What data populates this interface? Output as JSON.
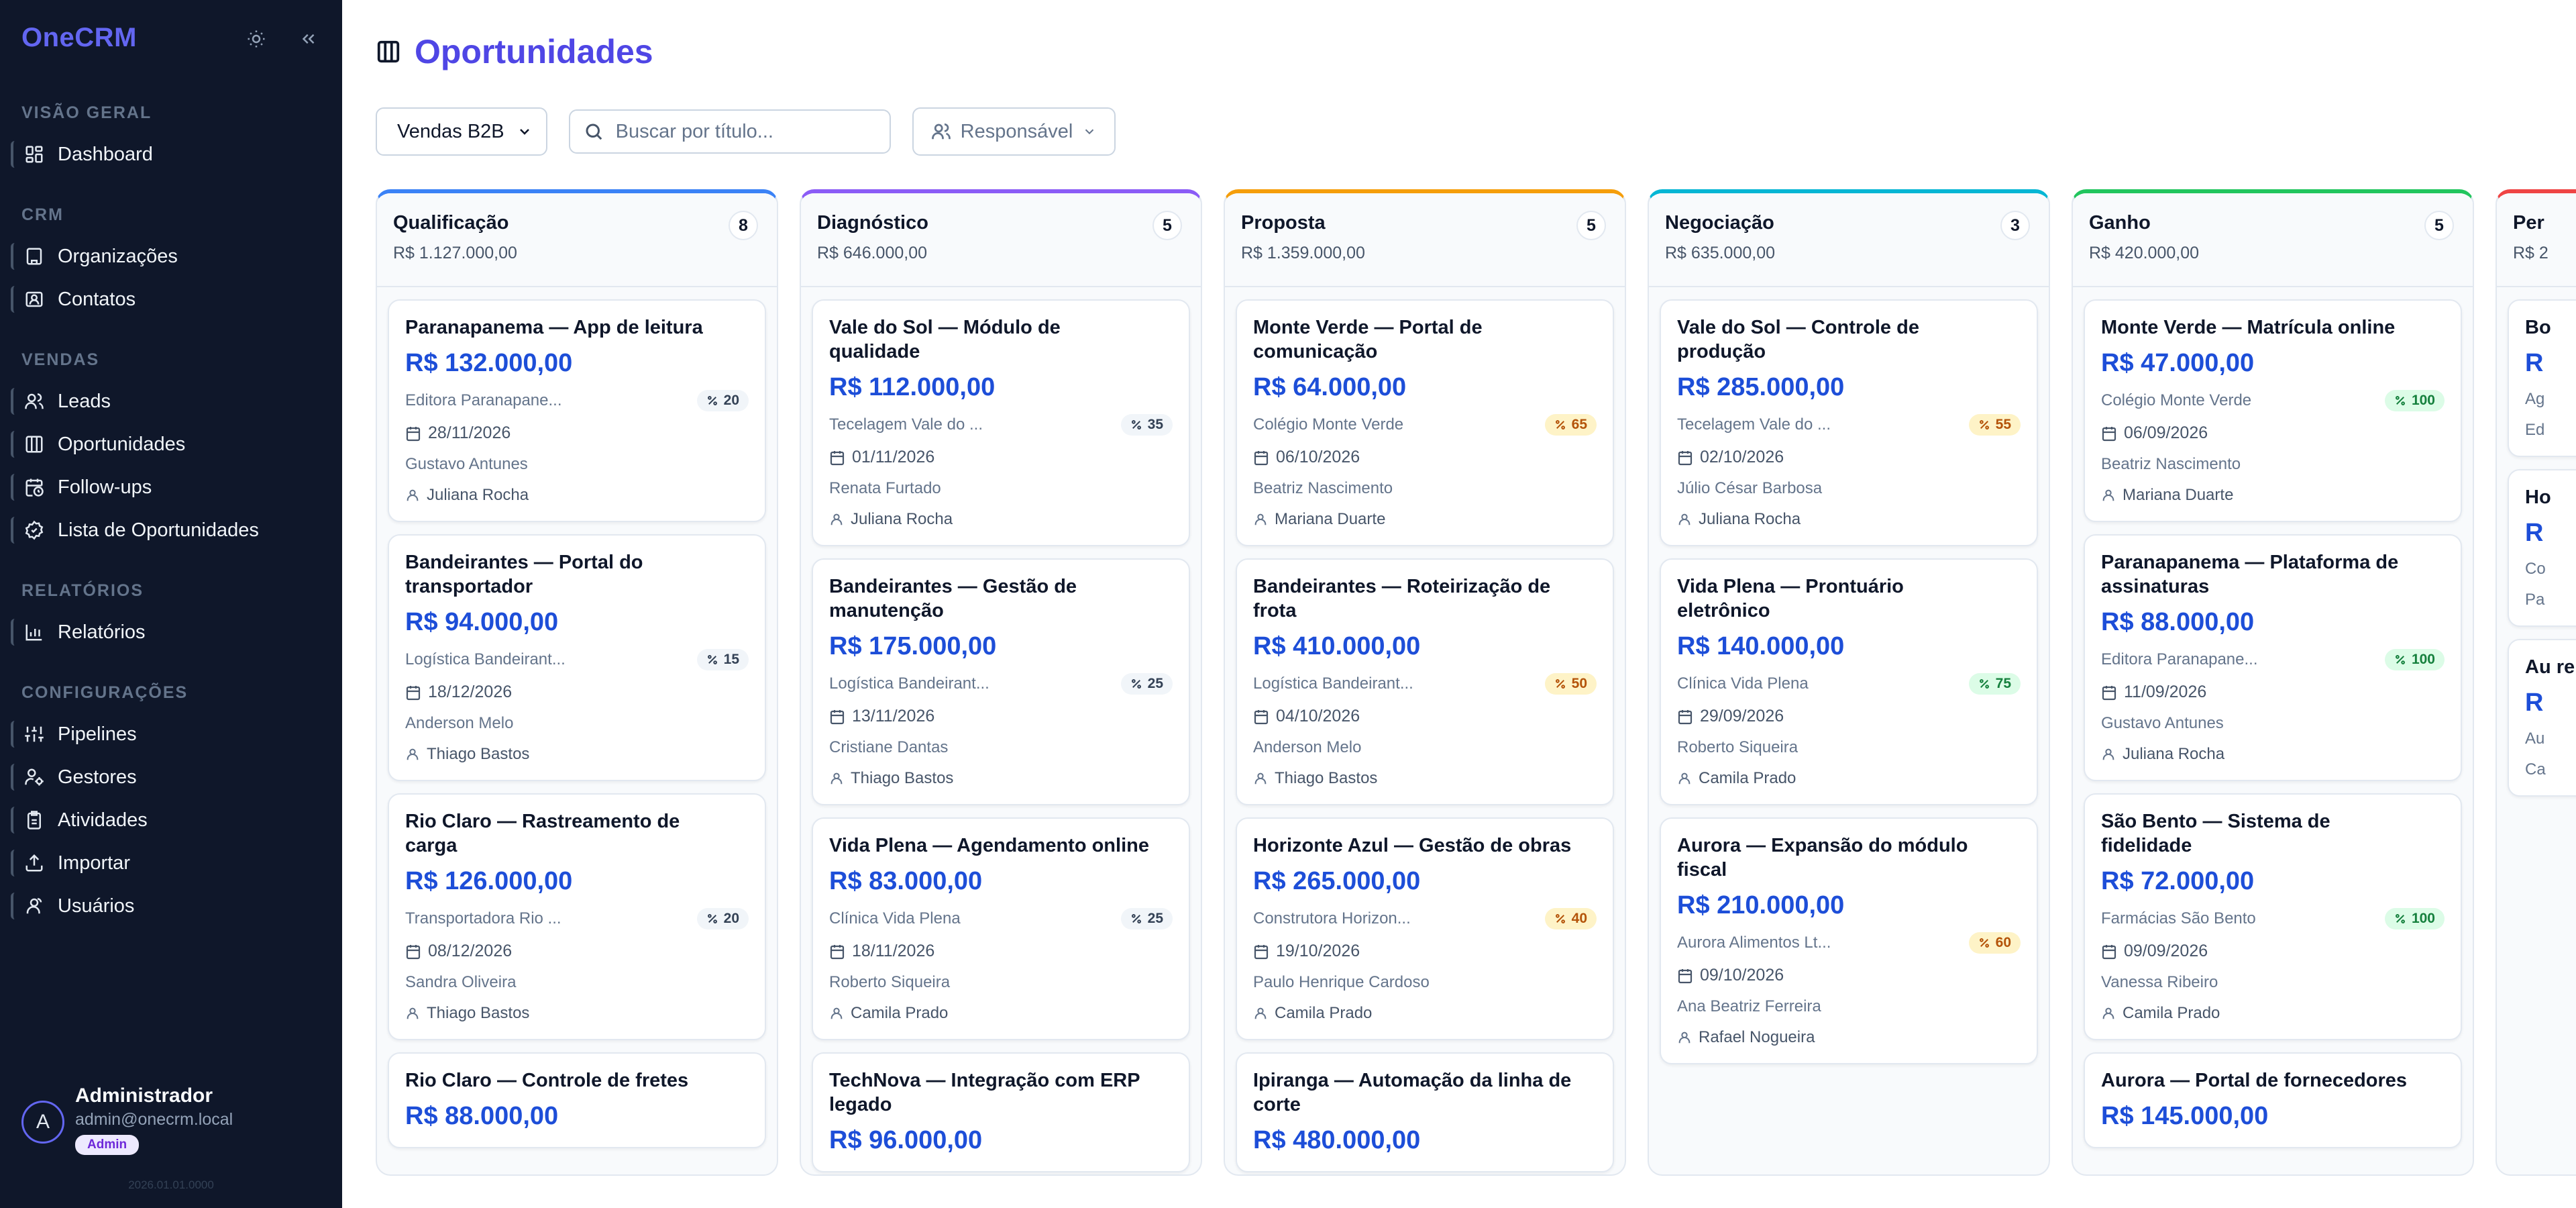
{
  "app": {
    "brand": "OneCRM"
  },
  "sidebar": {
    "groups": [
      {
        "title": "Visão geral",
        "items": [
          {
            "label": "Dashboard",
            "icon": "dashboard-icon"
          }
        ]
      },
      {
        "title": "CRM",
        "items": [
          {
            "label": "Organizações",
            "icon": "building-icon"
          },
          {
            "label": "Contatos",
            "icon": "contact-card-icon"
          }
        ]
      },
      {
        "title": "Vendas",
        "items": [
          {
            "label": "Leads",
            "icon": "users-icon"
          },
          {
            "label": "Oportunidades",
            "icon": "columns-icon"
          },
          {
            "label": "Follow-ups",
            "icon": "calendar-clock-icon"
          },
          {
            "label": "Lista de Oportunidades",
            "icon": "badge-check-icon"
          }
        ]
      },
      {
        "title": "Relatórios",
        "items": [
          {
            "label": "Relatórios",
            "icon": "bar-chart-icon"
          }
        ]
      },
      {
        "title": "Configurações",
        "items": [
          {
            "label": "Pipelines",
            "icon": "sliders-icon"
          },
          {
            "label": "Gestores",
            "icon": "user-cog-icon"
          },
          {
            "label": "Atividades",
            "icon": "clipboard-icon"
          },
          {
            "label": "Importar",
            "icon": "upload-icon"
          },
          {
            "label": "Usuários",
            "icon": "user-icon"
          }
        ]
      }
    ],
    "user": {
      "initial": "A",
      "name": "Administrador",
      "email": "admin@onecrm.local",
      "role": "Admin"
    },
    "version": "2026.01.01.0000"
  },
  "page": {
    "title": "Oportunidades"
  },
  "toolbar": {
    "pipeline_select": "Vendas B2B",
    "search_placeholder": "Buscar por título...",
    "owner_filter": "Responsável"
  },
  "colors": {
    "accent": "#4f46e5",
    "value": "#1d4ed8",
    "sidebar_bg": "#0f172a"
  },
  "columns": [
    {
      "title": "Qualificação",
      "count": "8",
      "total": "R$ 1.127.000,00",
      "color": "#3b82f6",
      "cards": [
        {
          "title": "Paranapanema — App de leitura",
          "value": "R$ 132.000,00",
          "org": "Editora Paranapane...",
          "prob": "20",
          "level": "low",
          "date": "28/11/2026",
          "contact": "Gustavo Antunes",
          "owner": "Juliana Rocha"
        },
        {
          "title": "Bandeirantes — Portal do transportador",
          "value": "R$ 94.000,00",
          "org": "Logística Bandeirant...",
          "prob": "15",
          "level": "low",
          "date": "18/12/2026",
          "contact": "Anderson Melo",
          "owner": "Thiago Bastos"
        },
        {
          "title": "Rio Claro — Rastreamento de carga",
          "value": "R$ 126.000,00",
          "org": "Transportadora Rio ...",
          "prob": "20",
          "level": "low",
          "date": "08/12/2026",
          "contact": "Sandra Oliveira",
          "owner": "Thiago Bastos"
        },
        {
          "title": "Rio Claro — Controle de fretes",
          "value": "R$ 88.000,00",
          "org": "",
          "prob": "",
          "level": "low",
          "date": "",
          "contact": "",
          "owner": ""
        }
      ]
    },
    {
      "title": "Diagnóstico",
      "count": "5",
      "total": "R$ 646.000,00",
      "color": "#8b5cf6",
      "cards": [
        {
          "title": "Vale do Sol — Módulo de qualidade",
          "value": "R$ 112.000,00",
          "org": "Tecelagem Vale do ...",
          "prob": "35",
          "level": "low",
          "date": "01/11/2026",
          "contact": "Renata Furtado",
          "owner": "Juliana Rocha"
        },
        {
          "title": "Bandeirantes — Gestão de manutenção",
          "value": "R$ 175.000,00",
          "org": "Logística Bandeirant...",
          "prob": "25",
          "level": "low",
          "date": "13/11/2026",
          "contact": "Cristiane Dantas",
          "owner": "Thiago Bastos"
        },
        {
          "title": "Vida Plena — Agendamento online",
          "value": "R$ 83.000,00",
          "org": "Clínica Vida Plena",
          "prob": "25",
          "level": "low",
          "date": "18/11/2026",
          "contact": "Roberto Siqueira",
          "owner": "Camila Prado"
        },
        {
          "title": "TechNova — Integração com ERP legado",
          "value": "R$ 96.000,00",
          "org": "",
          "prob": "",
          "level": "low",
          "date": "",
          "contact": "",
          "owner": ""
        }
      ]
    },
    {
      "title": "Proposta",
      "count": "5",
      "total": "R$ 1.359.000,00",
      "color": "#f59e0b",
      "cards": [
        {
          "title": "Monte Verde — Portal de comunicação",
          "value": "R$ 64.000,00",
          "org": "Colégio Monte Verde",
          "prob": "65",
          "level": "mid",
          "date": "06/10/2026",
          "contact": "Beatriz Nascimento",
          "owner": "Mariana Duarte"
        },
        {
          "title": "Bandeirantes — Roteirização de frota",
          "value": "R$ 410.000,00",
          "org": "Logística Bandeirant...",
          "prob": "50",
          "level": "mid",
          "date": "04/10/2026",
          "contact": "Anderson Melo",
          "owner": "Thiago Bastos"
        },
        {
          "title": "Horizonte Azul — Gestão de obras",
          "value": "R$ 265.000,00",
          "org": "Construtora Horizon...",
          "prob": "40",
          "level": "mid",
          "date": "19/10/2026",
          "contact": "Paulo Henrique Cardoso",
          "owner": "Camila Prado"
        },
        {
          "title": "Ipiranga — Automação da linha de corte",
          "value": "R$ 480.000,00",
          "org": "",
          "prob": "",
          "level": "mid",
          "date": "",
          "contact": "",
          "owner": ""
        }
      ]
    },
    {
      "title": "Negociação",
      "count": "3",
      "total": "R$ 635.000,00",
      "color": "#06b6d4",
      "cards": [
        {
          "title": "Vale do Sol — Controle de produção",
          "value": "R$ 285.000,00",
          "org": "Tecelagem Vale do ...",
          "prob": "55",
          "level": "mid",
          "date": "02/10/2026",
          "contact": "Júlio César Barbosa",
          "owner": "Juliana Rocha"
        },
        {
          "title": "Vida Plena — Prontuário eletrônico",
          "value": "R$ 140.000,00",
          "org": "Clínica Vida Plena",
          "prob": "75",
          "level": "high",
          "date": "29/09/2026",
          "contact": "Roberto Siqueira",
          "owner": "Camila Prado"
        },
        {
          "title": "Aurora — Expansão do módulo fiscal",
          "value": "R$ 210.000,00",
          "org": "Aurora Alimentos Lt...",
          "prob": "60",
          "level": "mid",
          "date": "09/10/2026",
          "contact": "Ana Beatriz Ferreira",
          "owner": "Rafael Nogueira"
        }
      ]
    },
    {
      "title": "Ganho",
      "count": "5",
      "total": "R$ 420.000,00",
      "color": "#22c55e",
      "cards": [
        {
          "title": "Monte Verde — Matrícula online",
          "value": "R$ 47.000,00",
          "org": "Colégio Monte Verde",
          "prob": "100",
          "level": "high",
          "date": "06/09/2026",
          "contact": "Beatriz Nascimento",
          "owner": "Mariana Duarte"
        },
        {
          "title": "Paranapanema — Plataforma de assinaturas",
          "value": "R$ 88.000,00",
          "org": "Editora Paranapane...",
          "prob": "100",
          "level": "high",
          "date": "11/09/2026",
          "contact": "Gustavo Antunes",
          "owner": "Juliana Rocha"
        },
        {
          "title": "São Bento — Sistema de fidelidade",
          "value": "R$ 72.000,00",
          "org": "Farmácias São Bento",
          "prob": "100",
          "level": "high",
          "date": "09/09/2026",
          "contact": "Vanessa Ribeiro",
          "owner": "Camila Prado"
        },
        {
          "title": "Aurora — Portal de fornecedores",
          "value": "R$ 145.000,00",
          "org": "",
          "prob": "",
          "level": "high",
          "date": "",
          "contact": "",
          "owner": ""
        }
      ]
    },
    {
      "title": "Per",
      "count": "",
      "total": "R$ 2",
      "color": "#ef4444",
      "cards": [
        {
          "title": "Bo",
          "value": "R",
          "org": "Ag",
          "prob": "",
          "level": "low",
          "date": "",
          "contact": "Ed",
          "owner": ""
        },
        {
          "title": "Ho",
          "value": "R",
          "org": "Co",
          "prob": "",
          "level": "low",
          "date": "",
          "contact": "Pa",
          "owner": ""
        },
        {
          "title": "Au re",
          "value": "R",
          "org": "Au",
          "prob": "",
          "level": "low",
          "date": "",
          "contact": "Ca",
          "owner": ""
        }
      ]
    }
  ]
}
